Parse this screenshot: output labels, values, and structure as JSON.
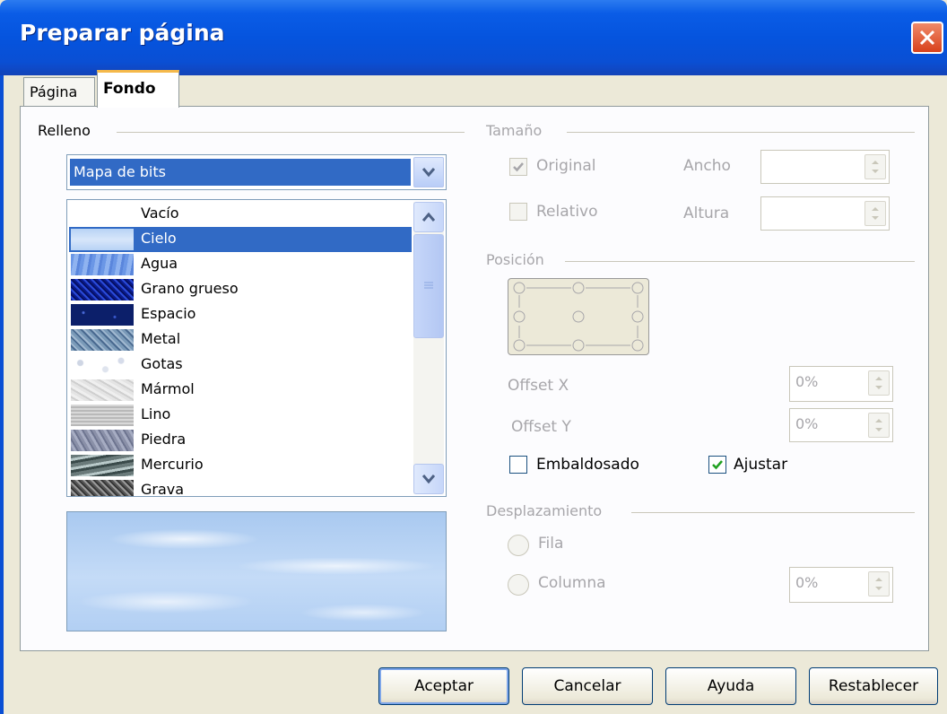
{
  "window": {
    "title": "Preparar página"
  },
  "tabs": [
    {
      "label": "Página"
    },
    {
      "label": "Fondo"
    }
  ],
  "fill": {
    "group_label": "Relleno",
    "type_selected": "Mapa de bits",
    "items": [
      {
        "label": "Vacío"
      },
      {
        "label": "Cielo"
      },
      {
        "label": "Agua"
      },
      {
        "label": "Grano grueso"
      },
      {
        "label": "Espacio"
      },
      {
        "label": "Metal"
      },
      {
        "label": "Gotas"
      },
      {
        "label": "Mármol"
      },
      {
        "label": "Lino"
      },
      {
        "label": "Piedra"
      },
      {
        "label": "Mercurio"
      },
      {
        "label": "Grava"
      }
    ],
    "selected_item": "Cielo"
  },
  "size": {
    "group_label": "Tamaño",
    "original_label": "Original",
    "relative_label": "Relativo",
    "width_label": "Ancho",
    "height_label": "Altura",
    "original_checked": true,
    "relative_checked": false
  },
  "position": {
    "group_label": "Posición",
    "offset_x_label": "Offset X",
    "offset_x_value": "0%",
    "offset_y_label": "Offset Y",
    "offset_y_value": "0%",
    "tile_label": "Embaldosado",
    "tile_checked": false,
    "fit_label": "Ajustar",
    "fit_checked": true
  },
  "displacement": {
    "group_label": "Desplazamiento",
    "row_label": "Fila",
    "column_label": "Columna",
    "value": "0%"
  },
  "buttons": {
    "ok": "Aceptar",
    "cancel": "Cancelar",
    "help": "Ayuda",
    "reset": "Restablecer"
  },
  "colors": {
    "title_bar": "#0554de",
    "selection": "#316ac5",
    "dialog_bg": "#ece9d8"
  }
}
